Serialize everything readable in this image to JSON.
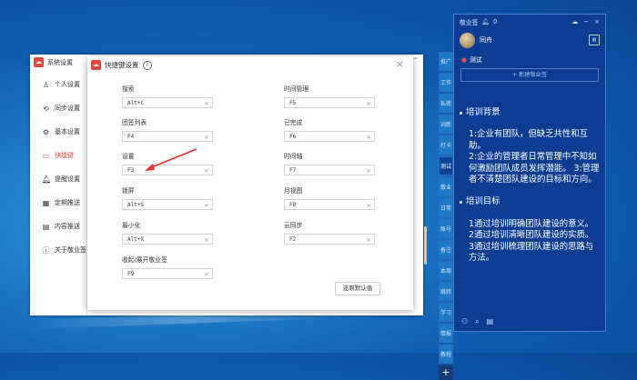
{
  "settings_window": {
    "title": "系统设置",
    "sidebar": [
      {
        "label": "个人设置",
        "icon": "user-icon",
        "active": false
      },
      {
        "label": "同步设置",
        "icon": "sync-icon",
        "active": false
      },
      {
        "label": "基本设置",
        "icon": "gear-icon",
        "active": false
      },
      {
        "label": "快捷键",
        "icon": "keyboard-icon",
        "active": true
      },
      {
        "label": "提醒设置",
        "icon": "bell-icon",
        "active": false
      },
      {
        "label": "定期推送",
        "icon": "calendar-icon",
        "active": false
      },
      {
        "label": "内容推送",
        "icon": "document-icon",
        "active": false
      },
      {
        "label": "关于敬业签",
        "icon": "info-icon",
        "active": false
      }
    ],
    "minimize_glyph": "−"
  },
  "dialog": {
    "title": "快捷键设置",
    "help_glyph": "?",
    "close_glyph": "×",
    "fields_left": [
      {
        "label": "搜索",
        "value": "Alt+C"
      },
      {
        "label": "团签列表",
        "value": "F4"
      },
      {
        "label": "设置",
        "value": "F3"
      },
      {
        "label": "锁屏",
        "value": "Alt+S"
      },
      {
        "label": "最小化",
        "value": "Alt+X"
      },
      {
        "label": "收起/展开敬业签",
        "value": "F9"
      }
    ],
    "fields_right": [
      {
        "label": "时间管理",
        "value": "F5"
      },
      {
        "label": "已完成",
        "value": "F6"
      },
      {
        "label": "时间轴",
        "value": "F7"
      },
      {
        "label": "月视图",
        "value": "F8"
      },
      {
        "label": "云同步",
        "value": "F2"
      }
    ],
    "clear_glyph": "×",
    "restore_label": "还原默认值"
  },
  "side_tabs": [
    "推广",
    "工作",
    "私密",
    "词新",
    "打卡",
    "测试",
    "敬业",
    "日常",
    "账号",
    "备注",
    "本周",
    "跳转",
    "学习",
    "情报",
    "教程"
  ],
  "active_tab": "测试",
  "notes": {
    "app_name": "敬业签",
    "bell_count": "0",
    "username": "同舟",
    "category": "测试",
    "new_note_label": "+ 新建敬业签",
    "sections": [
      {
        "heading": "培训背景",
        "paragraphs": [
          "1:企业有团队，但缺乏共性和互助。",
          "2:企业的管理者日常管理中不知如何激励团队成员发挥潜能。  3:管理者不清楚团队建设的目标和方向。"
        ]
      },
      {
        "heading": "培训目标",
        "paragraphs": [
          "1通过培训明确团队建设的意义。",
          "2通过培训清晰团队建设的实质。",
          "3通过培训梳理团队建设的思路与方法。"
        ]
      }
    ]
  },
  "colors": {
    "accent_red": "#e2463e",
    "panel_blue": "#0d3d93"
  }
}
